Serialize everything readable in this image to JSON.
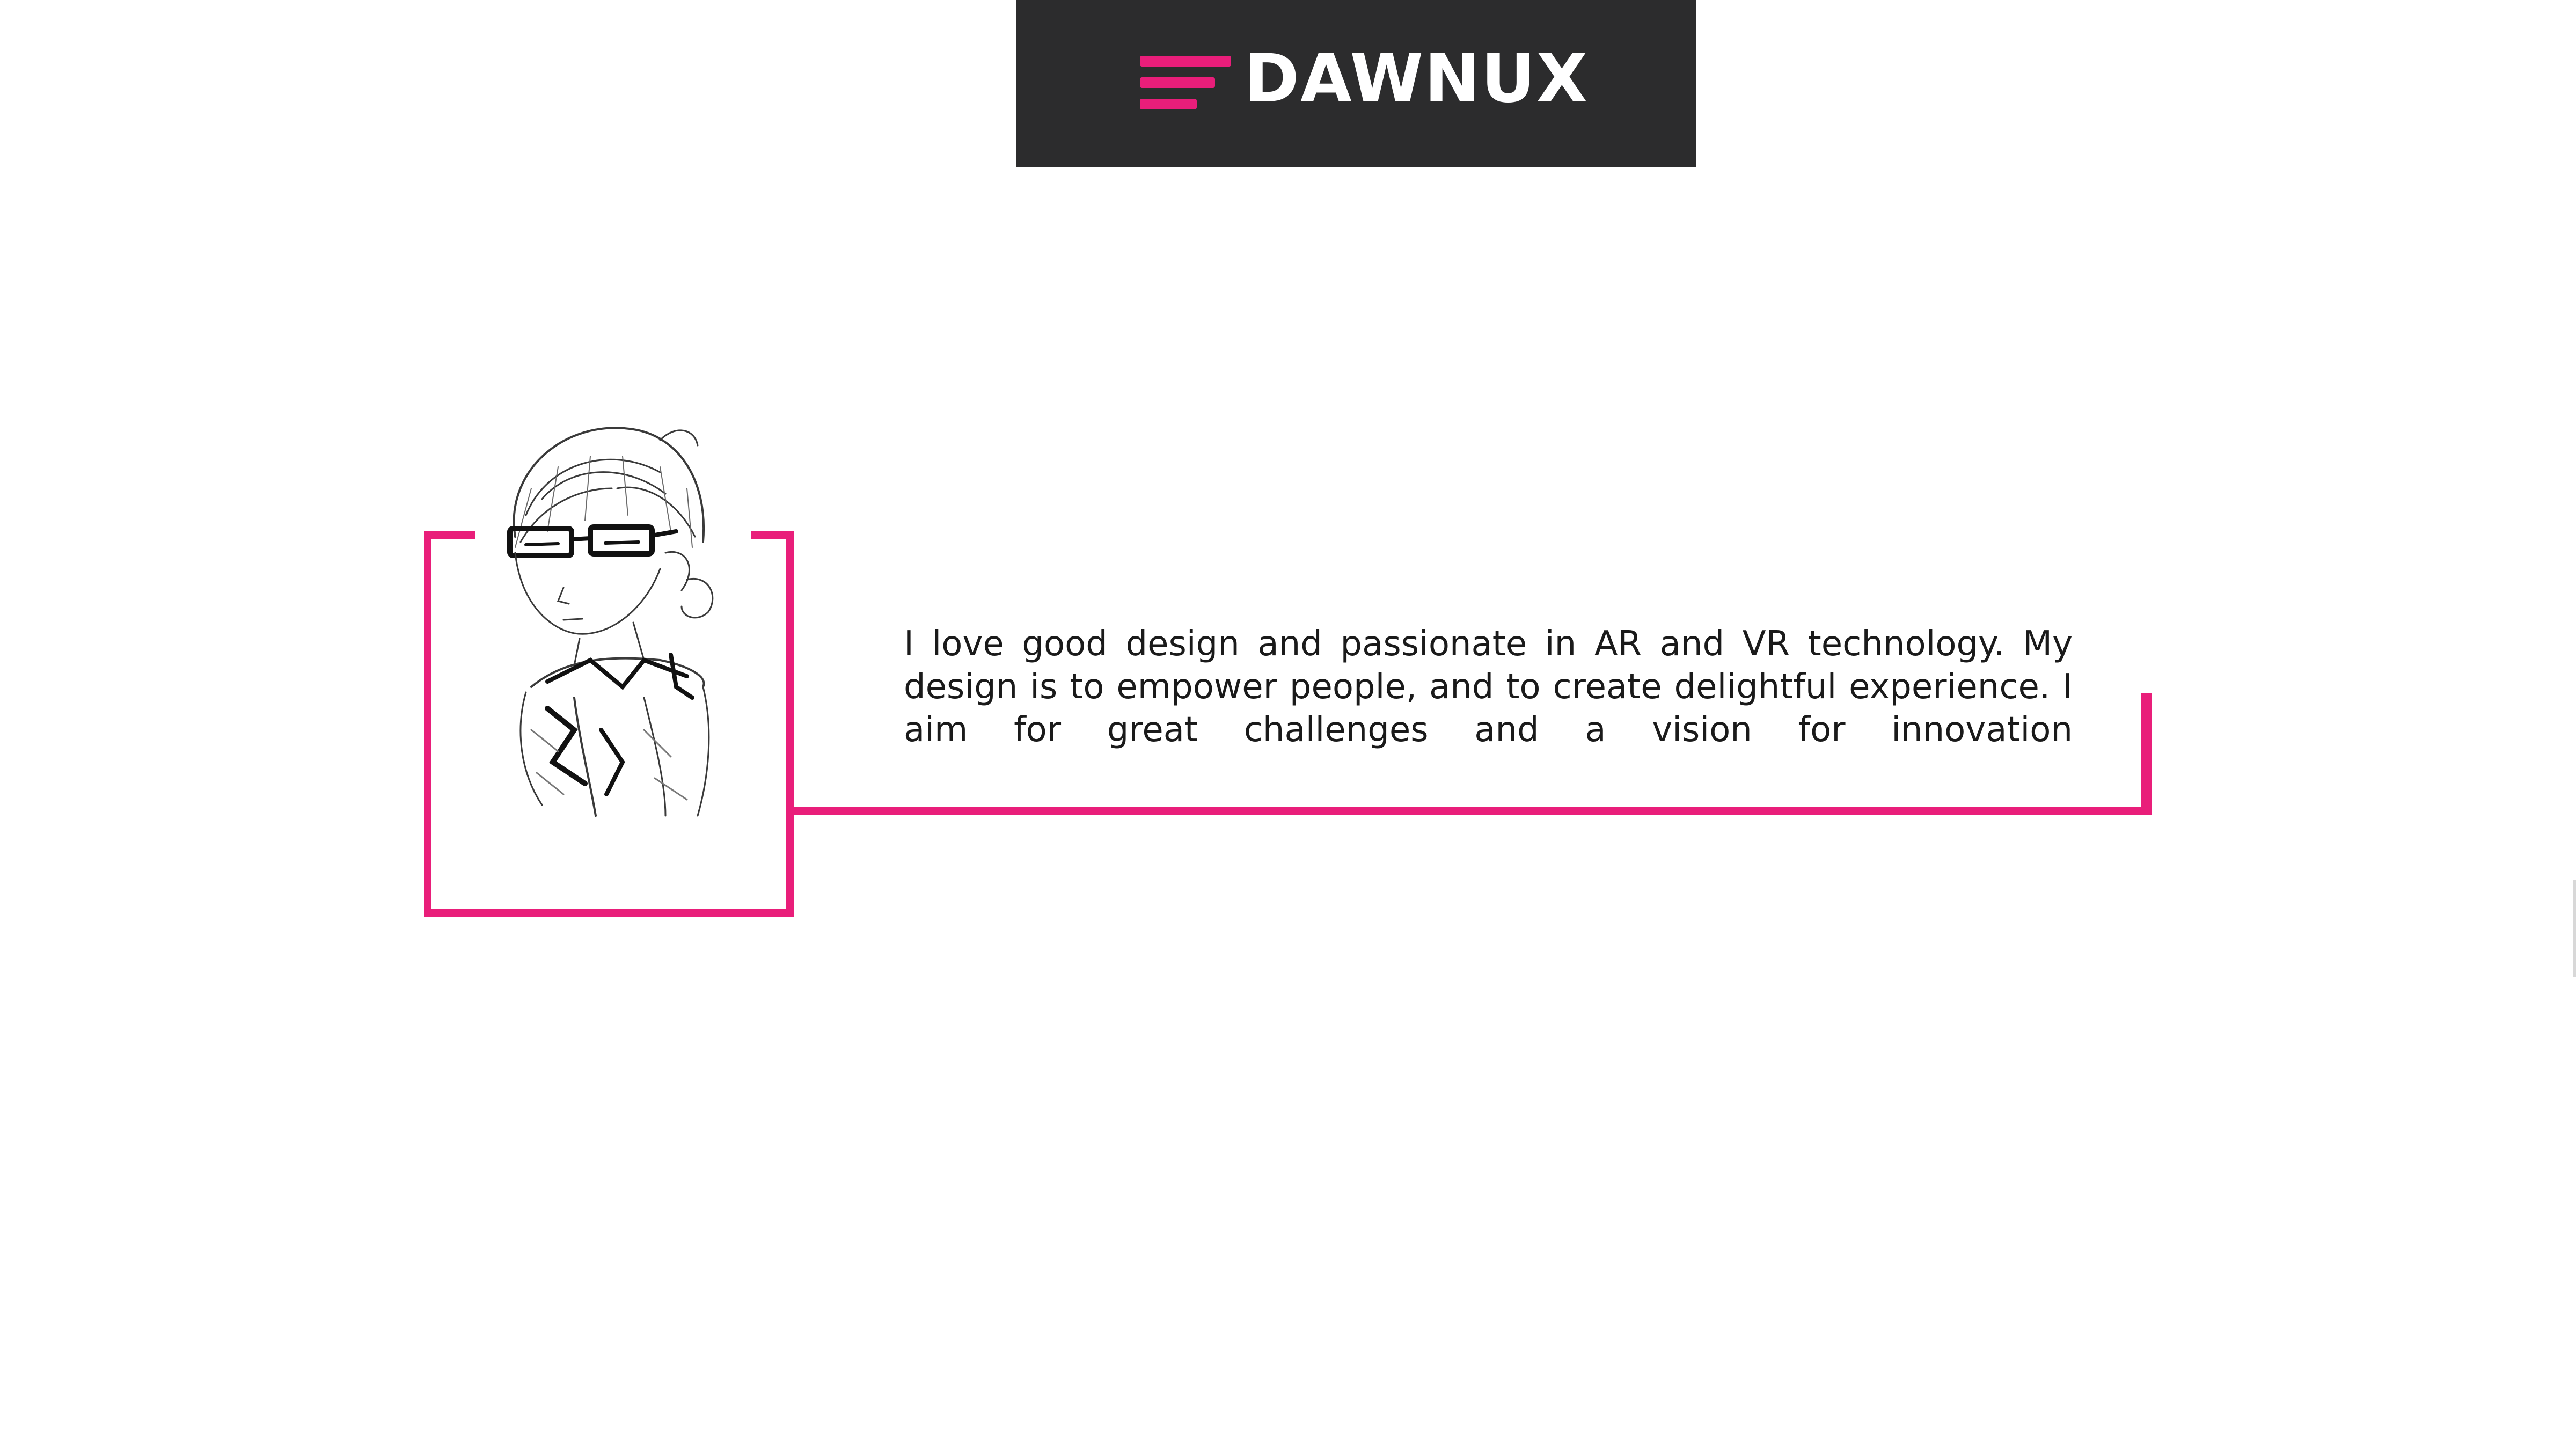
{
  "header": {
    "brand": "DAWNUX",
    "menu_icon": "hamburger-menu-icon"
  },
  "about": {
    "portrait": "sketch-portrait",
    "bio": "I love good design and passionate in AR and VR technology. My design is to empower people, and to create delightful experience. I aim for great challenges  and a vision for innovation"
  },
  "colors": {
    "accent": "#e91e7a",
    "header_bg": "#2c2c2d",
    "background": "#ffffff",
    "text": "#1a1a1a"
  }
}
